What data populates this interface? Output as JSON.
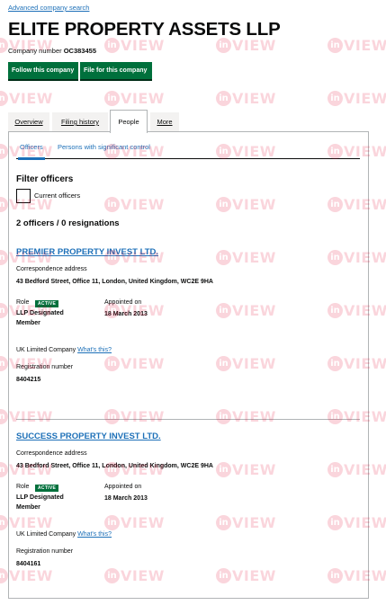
{
  "breadcrumb": {
    "label": "Advanced company search"
  },
  "company": {
    "name": "ELITE PROPERTY ASSETS LLP",
    "number_label": "Company number",
    "number": "OC383455"
  },
  "actions": {
    "follow_label": "Follow this company",
    "file_label": "File for this company"
  },
  "tabs": [
    {
      "label": "Overview",
      "selected": false
    },
    {
      "label": "Filing history",
      "selected": false
    },
    {
      "label": "People",
      "selected": true
    },
    {
      "label": "More",
      "selected": false
    }
  ],
  "subtabs": [
    {
      "label": "Officers",
      "selected": true
    },
    {
      "label": "Persons with significant control",
      "selected": false
    }
  ],
  "filter": {
    "title": "Filter officers",
    "checkbox_label": "Current officers",
    "checked": false
  },
  "summary": "2 officers / 0 resignations",
  "officers": [
    {
      "name": "PREMIER PROPERTY INVEST LTD.",
      "address_label": "Correspondence address",
      "address": "43 Bedford Street, Office 11, London, United Kingdom, WC2E 9HA",
      "role_label": "Role",
      "status": "ACTIVE",
      "role": "LLP Designated Member",
      "appointed_label": "Appointed on",
      "appointed": "18 March 2013",
      "type": "UK Limited Company",
      "whats_this": "What's this?",
      "registration_label": "Registration number",
      "registration": "8404215"
    },
    {
      "name": "SUCCESS PROPERTY INVEST LTD.",
      "address_label": "Correspondence address",
      "address": "43 Bedford Street, Office 11, London, United Kingdom, WC2E 9HA",
      "role_label": "Role",
      "status": "ACTIVE",
      "role": "LLP Designated Member",
      "appointed_label": "Appointed on",
      "appointed": "18 March 2013",
      "type": "UK Limited Company",
      "whats_this": "What's this?",
      "registration_label": "Registration number",
      "registration": "8404161"
    }
  ],
  "watermark": {
    "glyph": "in",
    "text": "VIEW"
  },
  "colors": {
    "link": "#1d70b8",
    "button": "#00703c",
    "badge": "#00703c",
    "watermark": "#e5002b"
  }
}
